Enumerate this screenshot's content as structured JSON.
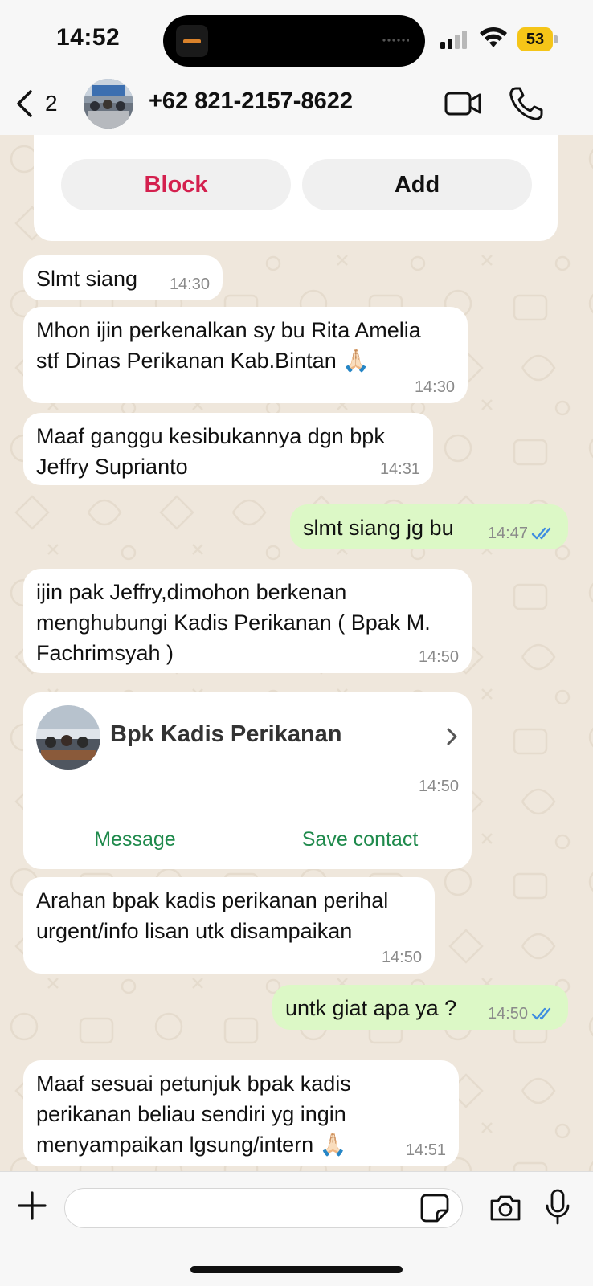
{
  "status_bar": {
    "time": "14:52",
    "battery": "53"
  },
  "header": {
    "back_count": "2",
    "contact": "+62 821-2157-8622"
  },
  "notice": {
    "block_label": "Block",
    "add_label": "Add"
  },
  "messages": [
    {
      "dir": "in",
      "text": "Slmt siang",
      "time": "14:30"
    },
    {
      "dir": "in",
      "text": "Mhon ijin perkenalkan sy bu Rita Amelia\nstf Dinas Perikanan Kab.Bintan 🙏🏻",
      "time": "14:30"
    },
    {
      "dir": "in",
      "text": "Maaf ganggu kesibukannya dgn bpk\nJeffry Suprianto",
      "time": "14:31"
    },
    {
      "dir": "out",
      "text": "slmt siang jg bu",
      "time": "14:47"
    },
    {
      "dir": "in",
      "text": "ijin pak Jeffry,dimohon berkenan\nmenghubungi Kadis Perikanan ( Bpak M.\nFachrimsyah )",
      "time": "14:50"
    },
    {
      "dir": "in",
      "text": "Arahan bpak kadis perikanan perihal\nurgent/info lisan utk disampaikan",
      "time": "14:50"
    },
    {
      "dir": "out",
      "text": "untk giat apa ya ?",
      "time": "14:50"
    },
    {
      "dir": "in",
      "text": "Maaf sesuai petunjuk bpak kadis\nperikanan beliau sendiri yg ingin\nmenyampaikan lgsung/intern 🙏🏻",
      "time": "14:51"
    }
  ],
  "contact_card": {
    "name": "Bpk Kadis Perikanan",
    "time": "14:50",
    "message_label": "Message",
    "save_label": "Save contact"
  },
  "composer": {
    "placeholder": ""
  },
  "colors": {
    "accent_green": "#1f8a4c",
    "block_red": "#d4204e",
    "read_tick": "#3f8de0",
    "outgoing": "#dcf8c6"
  }
}
